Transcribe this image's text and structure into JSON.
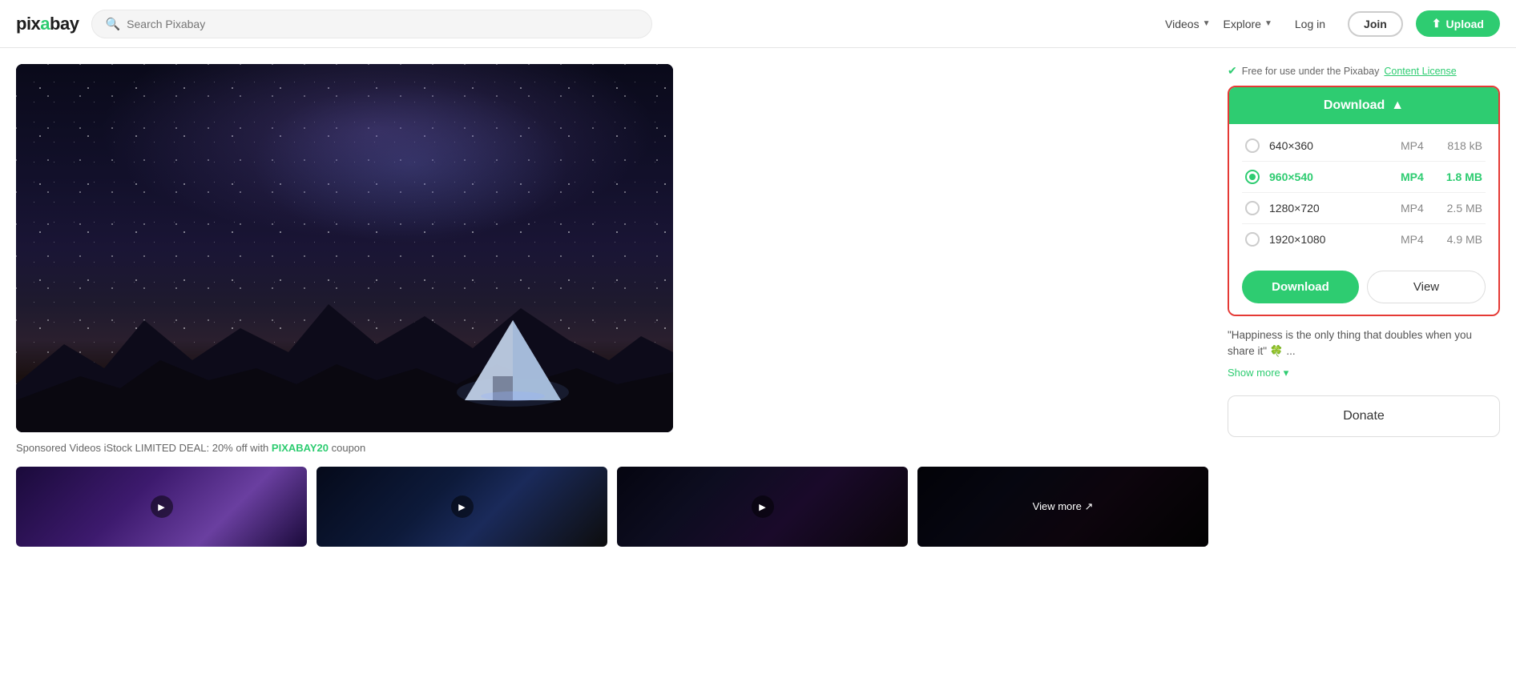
{
  "header": {
    "logo_text": "pixabay",
    "search_placeholder": "Search Pixabay",
    "media_type": "Videos",
    "explore_label": "Explore",
    "login_label": "Log in",
    "join_label": "Join",
    "upload_label": "Upload"
  },
  "license": {
    "check_text": "Free for use under the Pixabay",
    "link_text": "Content License"
  },
  "download_panel": {
    "header_label": "Download",
    "options": [
      {
        "id": "opt1",
        "resolution": "640×360",
        "format": "MP4",
        "size": "818 kB",
        "selected": false
      },
      {
        "id": "opt2",
        "resolution": "960×540",
        "format": "MP4",
        "size": "1.8 MB",
        "selected": true
      },
      {
        "id": "opt3",
        "resolution": "1280×720",
        "format": "MP4",
        "size": "2.5 MB",
        "selected": false
      },
      {
        "id": "opt4",
        "resolution": "1920×1080",
        "format": "MP4",
        "size": "4.9 MB",
        "selected": false
      }
    ],
    "download_btn": "Download",
    "view_btn": "View"
  },
  "description": {
    "text": "\"Happiness is the only thing that doubles when you share it\" 🍀 ...",
    "show_more": "Show more"
  },
  "donate": {
    "label": "Donate"
  },
  "sponsored": {
    "text": "Sponsored Videos iStock LIMITED DEAL: 20% off with",
    "code": "PIXABAY20",
    "suffix": "coupon"
  },
  "thumbnails": [
    {
      "id": "t1",
      "bg": "linear-gradient(135deg, #1a0a3a 0%, #3d1a6e 40%, #6a3fa0 70%, #1a0a3a 100%)"
    },
    {
      "id": "t2",
      "bg": "linear-gradient(135deg, #050a1a 0%, #0d1a3a 40%, #1a2a5a 60%, #0d0d0d 100%)"
    },
    {
      "id": "t3",
      "bg": "linear-gradient(135deg, #050510 0%, #0d0d20 30%, #1a0a2a 60%, #0a050a 100%)"
    },
    {
      "id": "t4",
      "bg": "linear-gradient(135deg, #050510 0%, #0d0d20 30%, #1a0a1a 60%, #050505 100%)",
      "view_more": true
    }
  ],
  "colors": {
    "green": "#2ecc71",
    "red_border": "#e53935"
  }
}
